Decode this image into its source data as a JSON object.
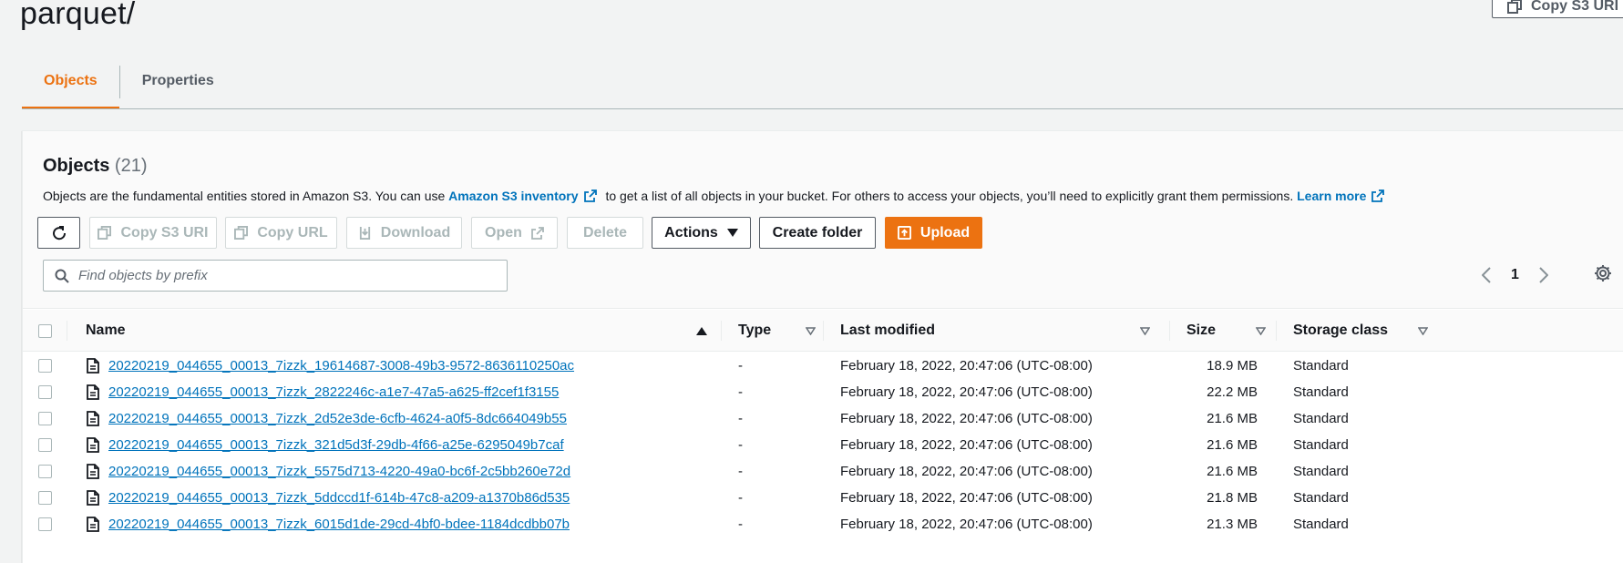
{
  "page": {
    "title": "parquet/",
    "copy_uri_label": "Copy S3 URI"
  },
  "tabs": [
    {
      "label": "Objects",
      "active": true
    },
    {
      "label": "Properties",
      "active": false
    }
  ],
  "objects_panel": {
    "title": "Objects",
    "count": "(21)",
    "description": {
      "before": "Objects are the fundamental entities stored in Amazon S3. You can use",
      "link1": "Amazon S3 inventory",
      "middle": "to get a list of all objects in your bucket. For others to access your objects, you’ll need to explicitly grant them permissions.",
      "link2": "Learn more"
    },
    "toolbar": {
      "copy_s3_uri": "Copy S3 URI",
      "copy_url": "Copy URL",
      "download": "Download",
      "open": "Open",
      "delete": "Delete",
      "actions": "Actions",
      "create_folder": "Create folder",
      "upload": "Upload"
    },
    "search": {
      "placeholder": "Find objects by prefix",
      "value": ""
    },
    "pagination": {
      "current_page": "1"
    }
  },
  "table": {
    "columns": {
      "name": "Name",
      "type": "Type",
      "last_modified": "Last modified",
      "size": "Size",
      "storage_class": "Storage class"
    },
    "rows": [
      {
        "name": "20220219_044655_00013_7izzk_19614687-3008-49b3-9572-8636110250ac",
        "type": "-",
        "last_modified": "February 18, 2022, 20:47:06 (UTC-08:00)",
        "size": "18.9 MB",
        "storage_class": "Standard"
      },
      {
        "name": "20220219_044655_00013_7izzk_2822246c-a1e7-47a5-a625-ff2cef1f3155",
        "type": "-",
        "last_modified": "February 18, 2022, 20:47:06 (UTC-08:00)",
        "size": "22.2 MB",
        "storage_class": "Standard"
      },
      {
        "name": "20220219_044655_00013_7izzk_2d52e3de-6cfb-4624-a0f5-8dc664049b55",
        "type": "-",
        "last_modified": "February 18, 2022, 20:47:06 (UTC-08:00)",
        "size": "21.6 MB",
        "storage_class": "Standard"
      },
      {
        "name": "20220219_044655_00013_7izzk_321d5d3f-29db-4f66-a25e-6295049b7caf",
        "type": "-",
        "last_modified": "February 18, 2022, 20:47:06 (UTC-08:00)",
        "size": "21.6 MB",
        "storage_class": "Standard"
      },
      {
        "name": "20220219_044655_00013_7izzk_5575d713-4220-49a0-bc6f-2c5bb260e72d",
        "type": "-",
        "last_modified": "February 18, 2022, 20:47:06 (UTC-08:00)",
        "size": "21.6 MB",
        "storage_class": "Standard"
      },
      {
        "name": "20220219_044655_00013_7izzk_5ddccd1f-614b-47c8-a209-a1370b86d535",
        "type": "-",
        "last_modified": "February 18, 2022, 20:47:06 (UTC-08:00)",
        "size": "21.8 MB",
        "storage_class": "Standard"
      },
      {
        "name": "20220219_044655_00013_7izzk_6015d1de-29cd-4bf0-bdee-1184dcdbb07b",
        "type": "-",
        "last_modified": "February 18, 2022, 20:47:06 (UTC-08:00)",
        "size": "21.3 MB",
        "storage_class": "Standard"
      }
    ]
  },
  "colors": {
    "accent": "#ec7211",
    "link": "#0073bb",
    "disabled": "#aab7b8"
  }
}
